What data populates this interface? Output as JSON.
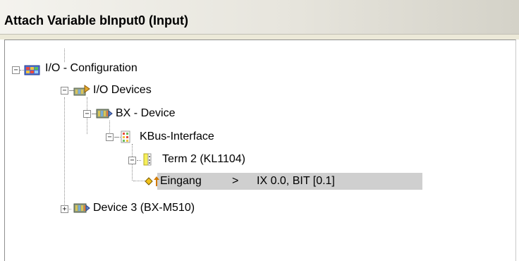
{
  "window": {
    "title": "Attach Variable bInput0 (Input)"
  },
  "tree": {
    "nodes": [
      {
        "label": "I/O - Configuration",
        "icon": "io-configuration-icon",
        "expanded": true
      },
      {
        "label": "I/O Devices",
        "icon": "io-devices-icon",
        "expanded": true
      },
      {
        "label": "BX - Device",
        "icon": "bx-device-icon",
        "expanded": true
      },
      {
        "label": "KBus-Interface",
        "icon": "kbus-interface-icon",
        "expanded": true
      },
      {
        "label": "Term 2 (KL1104)",
        "icon": "terminal-icon",
        "expanded": true
      },
      {
        "label": "Eingang",
        "arrow": ">",
        "address": "IX 0.0, BIT [0.1]",
        "icon": "input-variable-icon",
        "selected": true
      },
      {
        "label": "Device 3 (BX-M510)",
        "icon": "device-icon",
        "expanded": false
      }
    ],
    "expander_collapse": "−",
    "expander_expand": "+"
  },
  "colors": {
    "selection": "#cfcfcf",
    "title_gradient_end": "#d4d2c8"
  }
}
